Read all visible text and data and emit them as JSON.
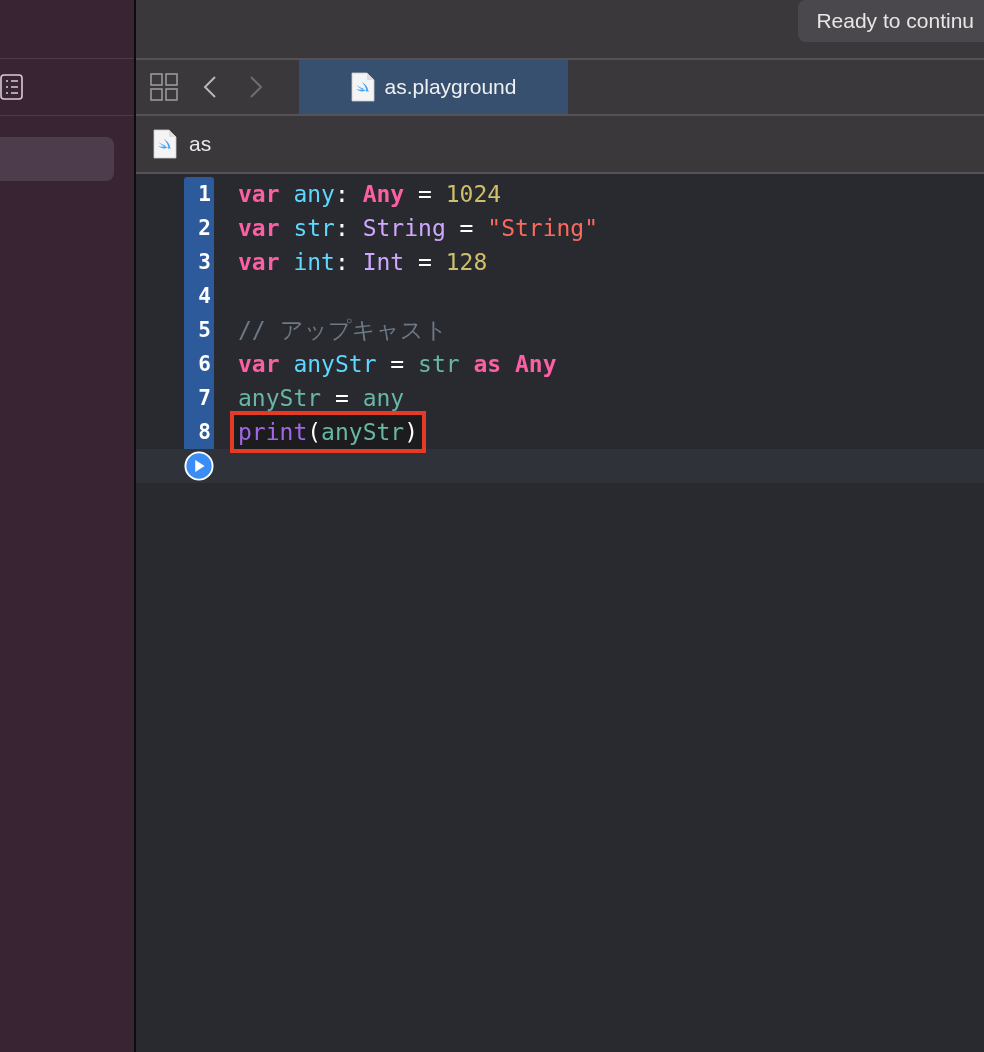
{
  "status": {
    "text": "Ready to continu"
  },
  "tab": {
    "label": "as.playground",
    "selected": true
  },
  "breadcrumb": {
    "label": "as"
  },
  "sidebar": {
    "items": [
      {
        "selected": true
      }
    ]
  },
  "code": {
    "lines": [
      {
        "number": "1",
        "highlighted": false,
        "tokens": [
          {
            "kind": "keyword",
            "text": "var "
          },
          {
            "kind": "identifier",
            "text": "any"
          },
          {
            "kind": "plain",
            "text": ": "
          },
          {
            "kind": "keyword",
            "text": "Any "
          },
          {
            "kind": "plain",
            "text": "= "
          },
          {
            "kind": "number",
            "text": "1024"
          }
        ]
      },
      {
        "number": "2",
        "highlighted": false,
        "tokens": [
          {
            "kind": "keyword",
            "text": "var "
          },
          {
            "kind": "identifier",
            "text": "str"
          },
          {
            "kind": "plain",
            "text": ": "
          },
          {
            "kind": "type",
            "text": "String "
          },
          {
            "kind": "plain",
            "text": "= "
          },
          {
            "kind": "string",
            "text": "\"String\""
          }
        ]
      },
      {
        "number": "3",
        "highlighted": false,
        "tokens": [
          {
            "kind": "keyword",
            "text": "var "
          },
          {
            "kind": "identifier",
            "text": "int"
          },
          {
            "kind": "plain",
            "text": ": "
          },
          {
            "kind": "type",
            "text": "Int "
          },
          {
            "kind": "plain",
            "text": "= "
          },
          {
            "kind": "number",
            "text": "128"
          }
        ]
      },
      {
        "number": "4"
      },
      {
        "number": "5",
        "highlighted": false,
        "tokens": [
          {
            "kind": "comment",
            "text": "// アップキャスト"
          }
        ]
      },
      {
        "number": "6",
        "highlighted": false,
        "tokens": [
          {
            "kind": "keyword",
            "text": "var "
          },
          {
            "kind": "identifier",
            "text": "anyStr "
          },
          {
            "kind": "plain",
            "text": "= "
          },
          {
            "kind": "variable",
            "text": "str "
          },
          {
            "kind": "keyword",
            "text": "as "
          },
          {
            "kind": "keyword",
            "text": "Any"
          }
        ]
      },
      {
        "number": "7",
        "highlighted": false,
        "tokens": [
          {
            "kind": "variable",
            "text": "anyStr "
          },
          {
            "kind": "plain",
            "text": "= "
          },
          {
            "kind": "variable",
            "text": "any"
          }
        ]
      },
      {
        "number": "8",
        "highlighted": true,
        "tokens": [
          {
            "kind": "function",
            "text": "print"
          },
          {
            "kind": "plain",
            "text": "("
          },
          {
            "kind": "variable",
            "text": "anyStr"
          },
          {
            "kind": "plain",
            "text": ")"
          }
        ]
      }
    ]
  }
}
